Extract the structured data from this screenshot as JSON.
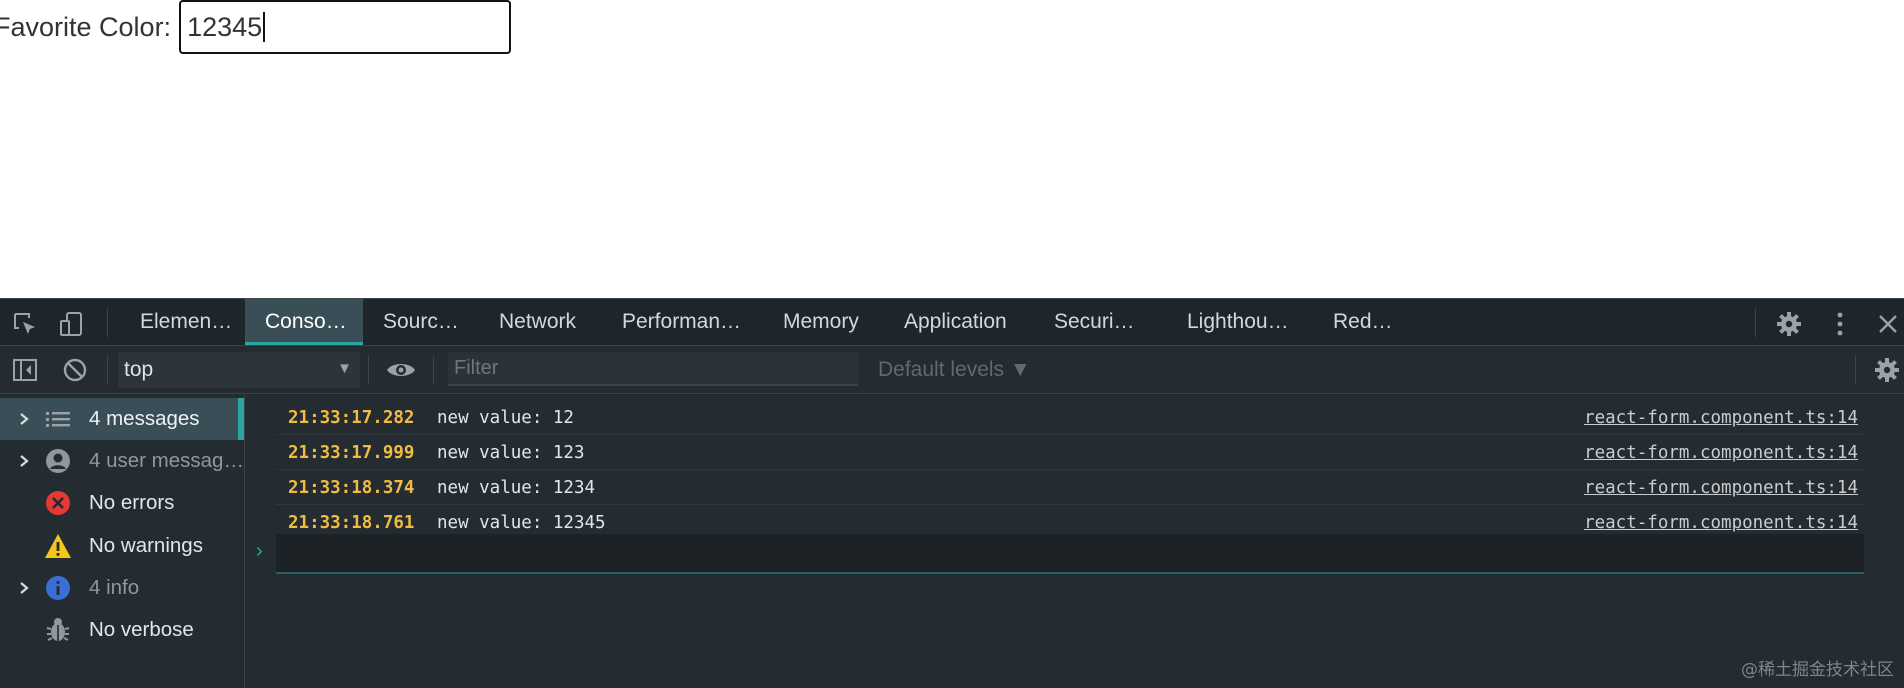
{
  "form": {
    "label": "Favorite Color:",
    "value": "12345"
  },
  "devtools": {
    "tabs": [
      {
        "label": "Elemen…",
        "active": false
      },
      {
        "label": "Conso…",
        "active": true
      },
      {
        "label": "Sourc…",
        "active": false
      },
      {
        "label": "Network",
        "active": false
      },
      {
        "label": "Performan…",
        "active": false
      },
      {
        "label": "Memory",
        "active": false
      },
      {
        "label": "Application",
        "active": false
      },
      {
        "label": "Securi…",
        "active": false
      },
      {
        "label": "Lighthou…",
        "active": false
      },
      {
        "label": "Red…",
        "active": false
      }
    ],
    "toolbar": {
      "context": "top",
      "filter_placeholder": "Filter",
      "levels": "Default levels ▼"
    },
    "sidebar": {
      "items": [
        {
          "label": "4 messages",
          "icon": "list-icon",
          "expandable": true,
          "active": true
        },
        {
          "label": "4 user messag…",
          "icon": "user-icon",
          "expandable": true,
          "active": false
        },
        {
          "label": "No errors",
          "icon": "error-icon",
          "expandable": false,
          "active": false
        },
        {
          "label": "No warnings",
          "icon": "warning-icon",
          "expandable": false,
          "active": false
        },
        {
          "label": "4 info",
          "icon": "info-icon",
          "expandable": true,
          "active": false
        },
        {
          "label": "No verbose",
          "icon": "bug-icon",
          "expandable": false,
          "active": false
        }
      ]
    },
    "messages": [
      {
        "time": "21:33:17.282",
        "text": "new value: 12",
        "source": "react-form.component.ts:14"
      },
      {
        "time": "21:33:17.999",
        "text": "new value: 123",
        "source": "react-form.component.ts:14"
      },
      {
        "time": "21:33:18.374",
        "text": "new value: 1234",
        "source": "react-form.component.ts:14"
      },
      {
        "time": "21:33:18.761",
        "text": "new value: 12345",
        "source": "react-form.component.ts:14"
      }
    ]
  },
  "watermark": "@稀土掘金技术社区",
  "colors": {
    "accent": "#2aa7a2",
    "timestamp": "#f1bc42",
    "error": "#e53935",
    "warning": "#f5c518",
    "info": "#3b6fd6"
  }
}
